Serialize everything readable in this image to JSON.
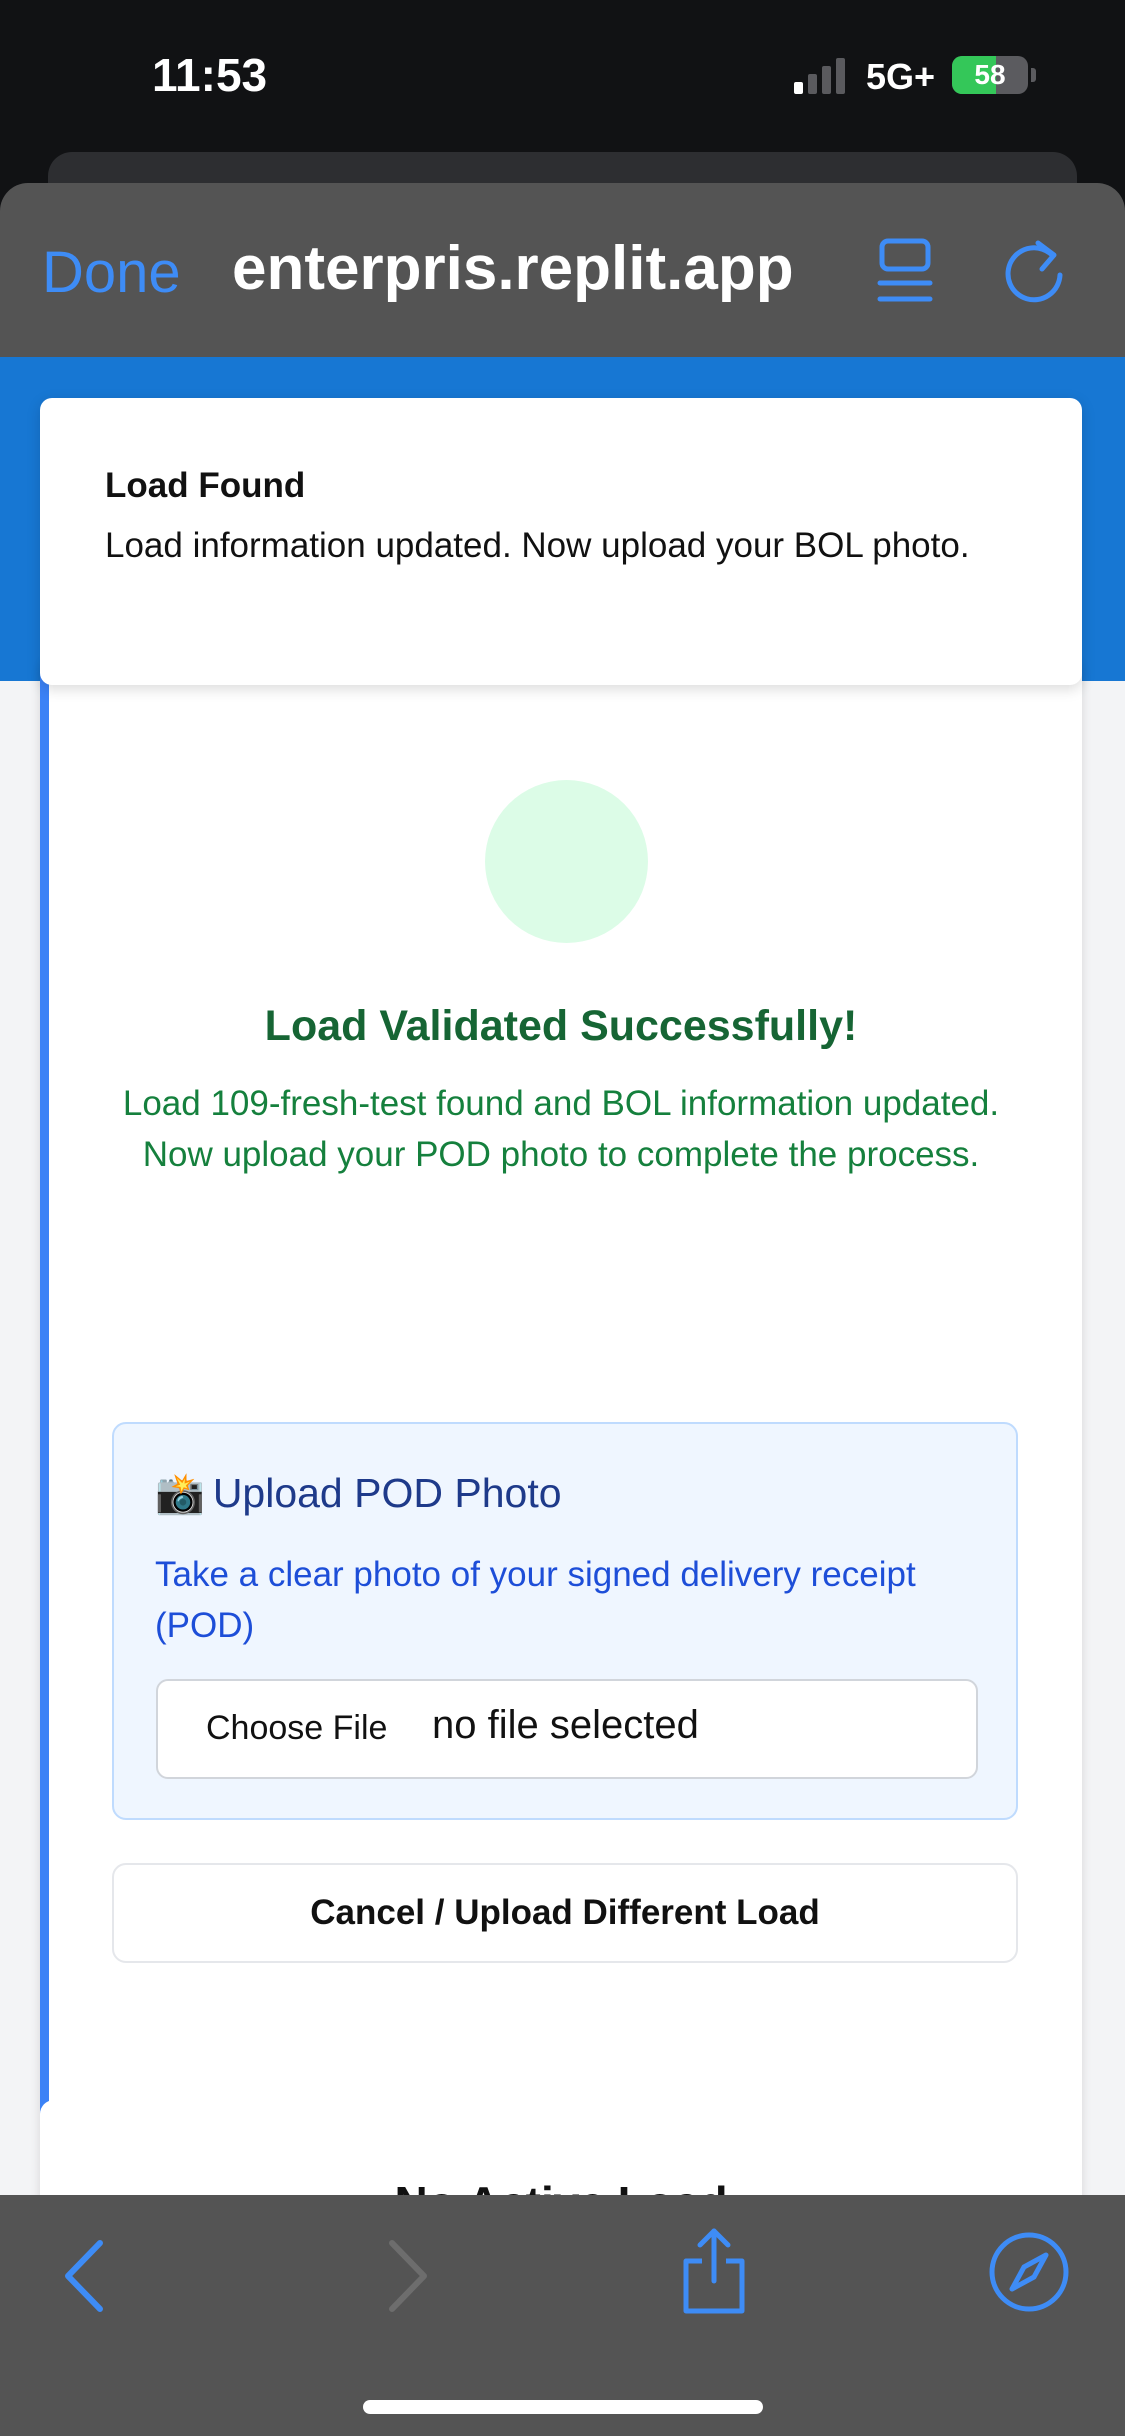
{
  "status_bar": {
    "time": "11:53",
    "network": "5G+",
    "battery_level": "58",
    "battery_fraction": 0.58
  },
  "browser": {
    "done_label": "Done",
    "url": "enterpris.replit.app",
    "reader_icon": "reader-mode-icon",
    "reload_icon": "reload-icon",
    "accent_color": "#3e8cf6"
  },
  "toast": {
    "title": "Load Found",
    "message": "Load information updated. Now upload your BOL photo."
  },
  "validation": {
    "title": "Load Validated Successfully!",
    "message_line1": "Load 109-fresh-test found and BOL information updated.",
    "message_line2": "Now upload your POD photo to complete the process."
  },
  "upload": {
    "icon": "📸",
    "title": "Upload POD Photo",
    "description": "Take a clear photo of your signed delivery receipt (POD)",
    "choose_file_label": "Choose File",
    "file_status": "no file selected"
  },
  "cancel_label": "Cancel / Upload Different Load",
  "next_card_title": "No Active Load",
  "toolbar": {
    "back_icon": "chevron-left-icon",
    "forward_icon": "chevron-right-icon",
    "share_icon": "share-icon",
    "safari_icon": "compass-icon"
  },
  "colors": {
    "header_blue": "#1777d3",
    "success_green": "#166534",
    "upload_blue": "#1d4ed8"
  }
}
